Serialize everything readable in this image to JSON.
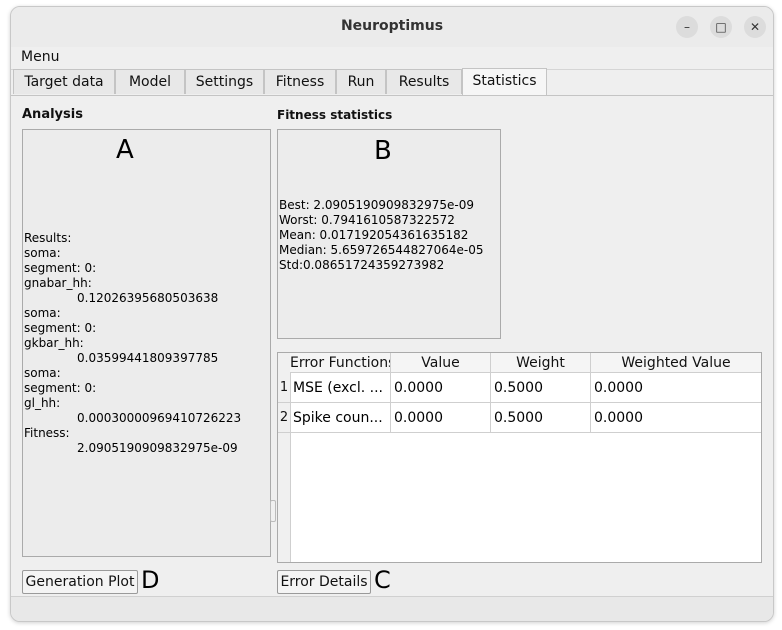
{
  "window": {
    "title": "Neuroptimus",
    "controls": {
      "minimize": "–",
      "maximize": "□",
      "close": "✕"
    }
  },
  "menu": {
    "label": "Menu"
  },
  "tabs": [
    {
      "label": "Target data"
    },
    {
      "label": "Model"
    },
    {
      "label": "Settings"
    },
    {
      "label": "Fitness"
    },
    {
      "label": "Run"
    },
    {
      "label": "Results"
    },
    {
      "label": "Statistics",
      "active": true
    }
  ],
  "analysis": {
    "heading": "Analysis",
    "marker": "A",
    "results_lines": [
      {
        "text": "Results:"
      },
      {
        "text": "soma:"
      },
      {
        "text": "segment: 0:"
      },
      {
        "text": "gnabar_hh:"
      },
      {
        "text": "0.12026395680503638",
        "indent": true
      },
      {
        "text": "soma:"
      },
      {
        "text": "segment: 0:"
      },
      {
        "text": "gkbar_hh:"
      },
      {
        "text": "0.03599441809397785",
        "indent": true
      },
      {
        "text": "soma:"
      },
      {
        "text": "segment: 0:"
      },
      {
        "text": "gl_hh:"
      },
      {
        "text": "0.00030000969410726223",
        "indent": true
      },
      {
        "text": "Fitness:"
      },
      {
        "text": "2.0905190909832975e-09",
        "indent": true
      }
    ]
  },
  "fitness_stats": {
    "heading": "Fitness statistics",
    "marker": "B",
    "lines": [
      "Best: 2.0905190909832975e-09",
      "Worst: 0.7941610587322572",
      "Mean: 0.017192054361635182",
      "Median: 5.659726544827064e-05",
      "Std:0.08651724359273982"
    ]
  },
  "error_table": {
    "headers": [
      "Error Functions",
      "Value",
      "Weight",
      "Weighted Value"
    ],
    "rows": [
      {
        "num": "1",
        "cells": [
          "MSE (excl. ...",
          "0.0000",
          "0.5000",
          "0.0000"
        ]
      },
      {
        "num": "2",
        "cells": [
          "Spike coun...",
          "0.0000",
          "0.5000",
          "0.0000"
        ]
      }
    ]
  },
  "buttons": {
    "generation_plot": "Generation Plot",
    "generation_marker": "D",
    "error_details": "Error Details",
    "error_marker": "C"
  }
}
